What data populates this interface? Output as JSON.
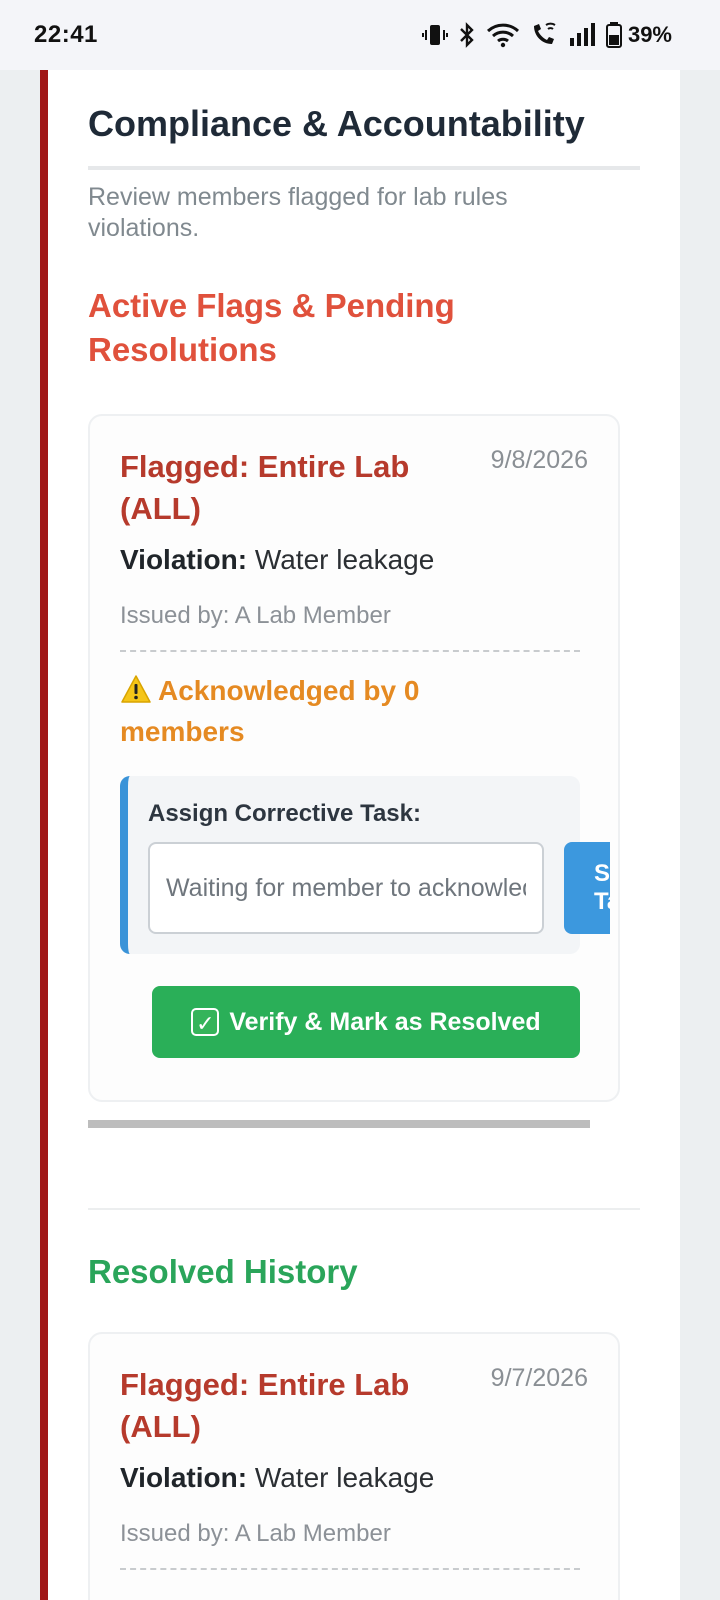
{
  "status_bar": {
    "time": "22:41",
    "battery": "39%",
    "icons": [
      "vibrate-icon",
      "bluetooth-icon",
      "wifi-icon",
      "wifi-calling-icon",
      "signal-icon",
      "battery-icon"
    ]
  },
  "page": {
    "title": "Compliance & Accountability",
    "subtitle": "Review members flagged for lab rules violations.",
    "accent_color": "#a11717"
  },
  "active_section": {
    "heading": "Active Flags & Pending Resolutions",
    "color": "#e0513c",
    "flags": [
      {
        "title": "Flagged: Entire Lab (ALL)",
        "date": "9/8/2026",
        "violation_label": "Violation:",
        "violation": "Water leakage",
        "issued_by": "Issued by: A Lab Member",
        "acknowledgement": "Acknowledged by 0 members",
        "task_label": "Assign Corrective Task:",
        "task_placeholder": "Waiting for member to acknowledge",
        "save_button": "Save\nTask",
        "verify_button": "Verify & Mark as Resolved"
      }
    ]
  },
  "resolved_section": {
    "heading": "Resolved History",
    "color": "#2aa55a",
    "flags": [
      {
        "title": "Flagged: Entire Lab (ALL)",
        "date": "9/7/2026",
        "violation_label": "Violation:",
        "violation": "Water leakage",
        "issued_by": "Issued by: A Lab Member"
      }
    ]
  }
}
